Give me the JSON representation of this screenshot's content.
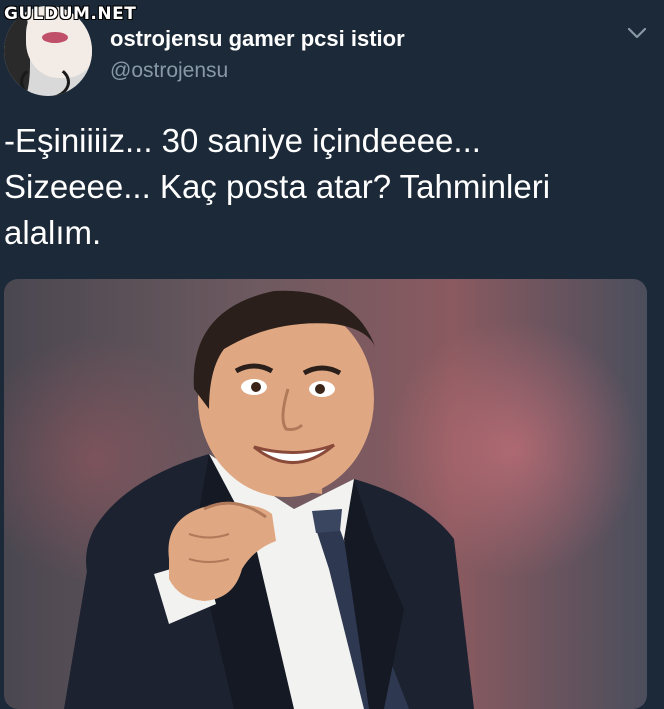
{
  "watermark": "GULDUM.NET",
  "tweet": {
    "display_name": "ostrojensu gamer pcsi istior",
    "handle": "@ostrojensu",
    "text": "-Eşiniiiiz... 30 saniye içindeeee...\nSizeeee... Kaç posta atar? Tahminleri\nalalım.",
    "menu_icon": "chevron-down-icon"
  },
  "colors": {
    "background": "#1c2938",
    "text": "#ffffff",
    "secondary_text": "#8899a6"
  }
}
